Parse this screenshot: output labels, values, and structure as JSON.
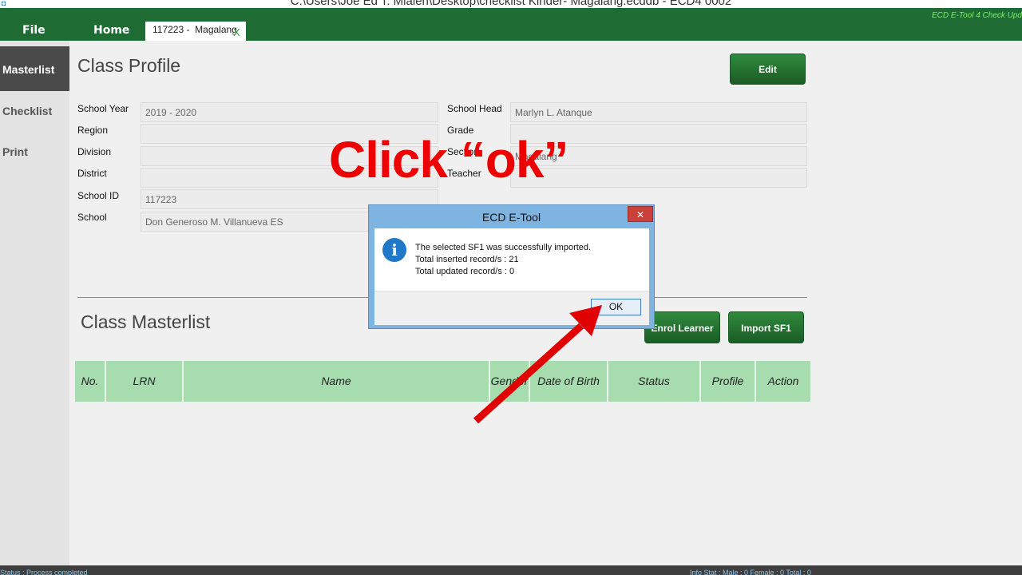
{
  "window": {
    "title": "C:\\Users\\Joe Ed T. Mialen\\Desktop\\checklist Kinder- Magalang.ecddb  -  ECD4 0002",
    "update_link": "ECD E-Tool 4 Check Upd"
  },
  "menubar": {
    "file_label": "File",
    "home_label": "Home",
    "doc_tab": {
      "label": "117223 -  Magalang",
      "close_glyph": "X"
    }
  },
  "sidebar": {
    "items": [
      {
        "label": "Masterlist",
        "active": true
      },
      {
        "label": "Checklist",
        "active": false
      },
      {
        "label": "Print",
        "active": false
      }
    ]
  },
  "class_profile": {
    "title": "Class Profile",
    "edit_label": "Edit",
    "fields_left": [
      {
        "label": "School Year",
        "value": "2019 - 2020"
      },
      {
        "label": "Region",
        "value": ""
      },
      {
        "label": "Division",
        "value": ""
      },
      {
        "label": "District",
        "value": ""
      },
      {
        "label": "School ID",
        "value": "117223"
      },
      {
        "label": "School",
        "value": "Don Generoso M. Villanueva ES"
      }
    ],
    "fields_right": [
      {
        "label": "School Head",
        "value": "Marlyn L. Atanque"
      },
      {
        "label": "Grade",
        "value": ""
      },
      {
        "label": "Section",
        "value": "Magalang"
      },
      {
        "label": "Teacher",
        "value": ""
      }
    ]
  },
  "masterlist": {
    "title": "Class Masterlist",
    "enrol_label": "Enrol Learner",
    "import_label": "Import SF1",
    "columns": [
      "No.",
      "LRN",
      "Name",
      "Gender",
      "Date of Birth",
      "Status",
      "Profile",
      "Action"
    ]
  },
  "statusbar": {
    "left": "Status : Process completed",
    "right": "Info Stat : Male : 0   Female : 0   Total : 0"
  },
  "annotation": {
    "text": "Click “ok”",
    "color": "#e00000"
  },
  "dialog": {
    "title": "ECD E-Tool",
    "close_glyph": "✕",
    "icon": "info-icon",
    "lines": [
      "The selected SF1 was successfully imported.",
      "Total inserted record/s : 21",
      "Total updated record/s : 0"
    ],
    "ok_label": "OK"
  },
  "colors": {
    "menubar": "#1e6b34",
    "table_header": "#a6dcae",
    "accent_green": "#1b5c26",
    "dialog_frame": "#7fb3e0"
  }
}
